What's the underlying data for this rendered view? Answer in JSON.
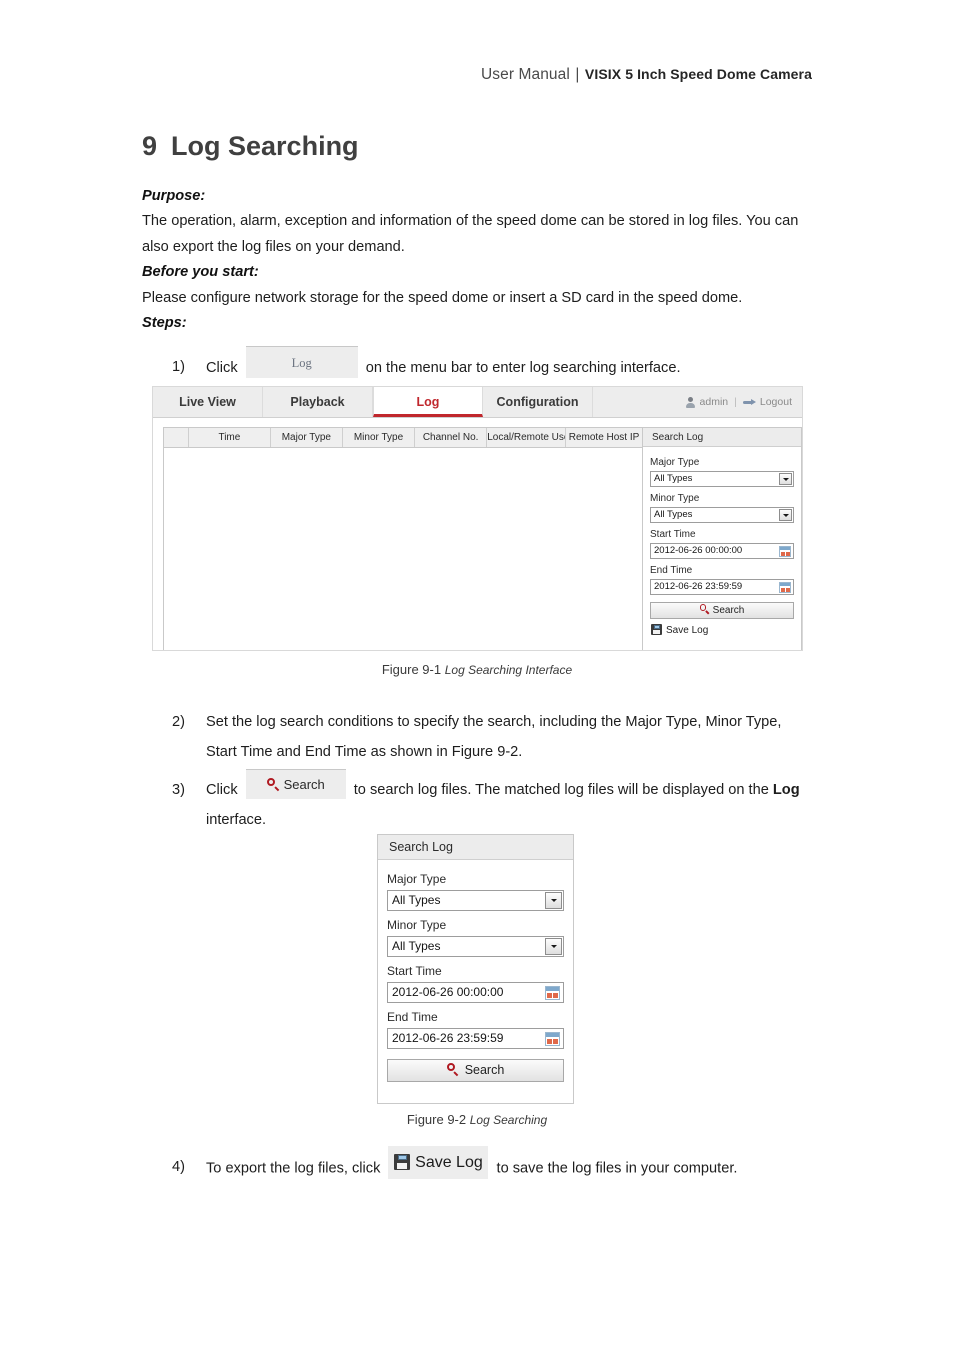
{
  "header": {
    "left": "User Manual",
    "separator": "|",
    "right": "VISIX 5 Inch Speed Dome Camera"
  },
  "chapter": {
    "number": "9",
    "title": "Log Searching"
  },
  "sections": {
    "purpose_label": "Purpose:",
    "purpose_text": "The operation, alarm, exception and information of the speed dome can be stored in log files. You can also export the log files on your demand.",
    "purpose_line1": "The operation, alarm, exception and information of the speed dome can be stored in log files. You can",
    "purpose_line2": "also export the log files on your demand.",
    "before_label": "Before you start:",
    "before_text": "Please configure network storage for the speed dome or insert a SD card in the speed dome.",
    "steps_label": "Steps:"
  },
  "steps": [
    {
      "number": "1)",
      "before": "Click",
      "button_label": "Log",
      "after": "on the menu bar to enter log searching interface."
    },
    {
      "number": "2)",
      "text": "Set the log search conditions to specify the search, including the Major Type, Minor Type, Start Time and End Time as shown in Figure 9-2."
    },
    {
      "number": "3)",
      "before": "Click",
      "button_label": "Search",
      "after_part1": "to search log files. The matched log files will be displayed on the ",
      "after_bold": "Log",
      "after_part2": " interface."
    },
    {
      "number": "4)",
      "before": "To export the log files, click",
      "button_label": "Save Log",
      "after": "to save the log files in your computer."
    }
  ],
  "captions": {
    "fig1_num": "Figure 9-1 ",
    "fig1_title": "Log Searching Interface",
    "fig2_num": "Figure 9-2 ",
    "fig2_title": "Log Searching"
  },
  "figure1": {
    "tabs": [
      {
        "label": "Live View",
        "active": false
      },
      {
        "label": "Playback",
        "active": false
      },
      {
        "label": "Log",
        "active": true
      },
      {
        "label": "Configuration",
        "active": false
      }
    ],
    "user": "admin",
    "pipe": "|",
    "logout": "Logout",
    "table_headers": [
      "",
      "Time",
      "Major Type",
      "Minor Type",
      "Channel No.",
      "Local/Remote User",
      "Remote Host IP"
    ],
    "panel": {
      "title": "Search Log",
      "major_type_label": "Major Type",
      "major_type_value": "All Types",
      "minor_type_label": "Minor Type",
      "minor_type_value": "All Types",
      "start_time_label": "Start Time",
      "start_time_value": "2012-06-26 00:00:00",
      "end_time_label": "End Time",
      "end_time_value": "2012-06-26 23:59:59",
      "search_button": "Search",
      "save_log": "Save Log"
    }
  },
  "figure2": {
    "title": "Search Log",
    "major_type_label": "Major Type",
    "major_type_value": "All Types",
    "minor_type_label": "Minor Type",
    "minor_type_value": "All Types",
    "start_time_label": "Start Time",
    "start_time_value": "2012-06-26 00:00:00",
    "end_time_label": "End Time",
    "end_time_value": "2012-06-26 23:59:59",
    "search_button": "Search"
  },
  "colors": {
    "accent_red": "#c0272d",
    "title_gray": "#404040",
    "panel_gray": "#ececec"
  }
}
